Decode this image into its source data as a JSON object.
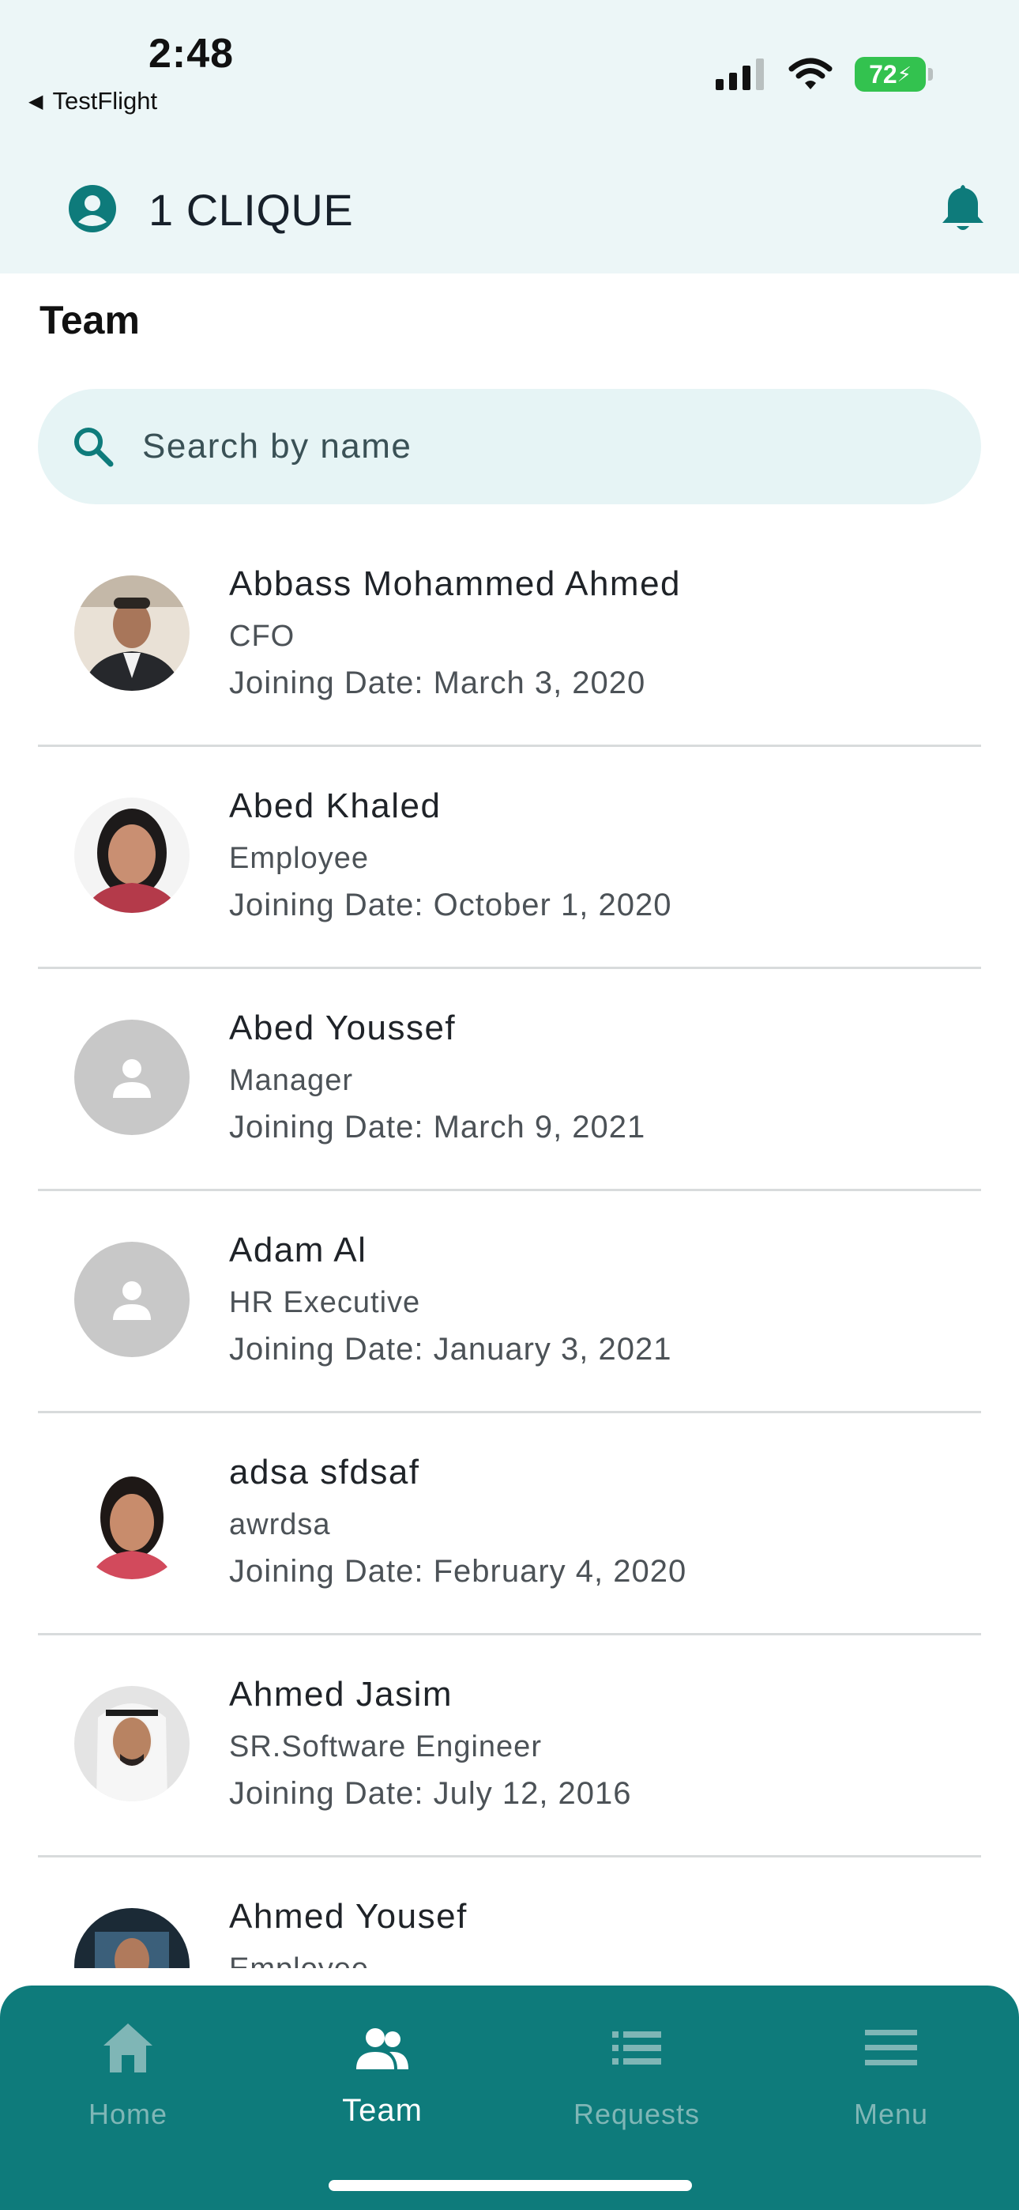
{
  "status_bar": {
    "time": "2:48",
    "back_app": "TestFlight",
    "battery": "72"
  },
  "app_bar": {
    "title": "1 CLIQUE"
  },
  "page": {
    "title": "Team"
  },
  "search": {
    "placeholder": "Search by name",
    "value": ""
  },
  "team": [
    {
      "name": "Abbass Mohammed Ahmed",
      "role": "CFO",
      "joining": "Joining Date: March 3, 2020",
      "avatar": "photo"
    },
    {
      "name": "Abed Khaled",
      "role": "Employee",
      "joining": "Joining Date: October 1, 2020",
      "avatar": "photo"
    },
    {
      "name": "Abed Youssef",
      "role": "Manager",
      "joining": "Joining Date: March 9, 2021",
      "avatar": "placeholder"
    },
    {
      "name": "Adam Al",
      "role": "HR Executive",
      "joining": "Joining Date: January 3, 2021",
      "avatar": "placeholder"
    },
    {
      "name": "adsa sfdsaf",
      "role": "awrdsa",
      "joining": "Joining Date: February 4, 2020",
      "avatar": "photo"
    },
    {
      "name": "Ahmed Jasim",
      "role": "SR.Software Engineer",
      "joining": "Joining Date: July 12, 2016",
      "avatar": "photo"
    },
    {
      "name": "Ahmed Yousef",
      "role": "Employee",
      "joining": "",
      "avatar": "photo"
    }
  ],
  "bottom_nav": {
    "home": "Home",
    "team": "Team",
    "requests": "Requests",
    "menu": "Menu",
    "active": "team"
  },
  "colors": {
    "accent": "#0e7b7b",
    "header_bg": "#ecf6f7",
    "search_bg": "#e6f4f5"
  }
}
